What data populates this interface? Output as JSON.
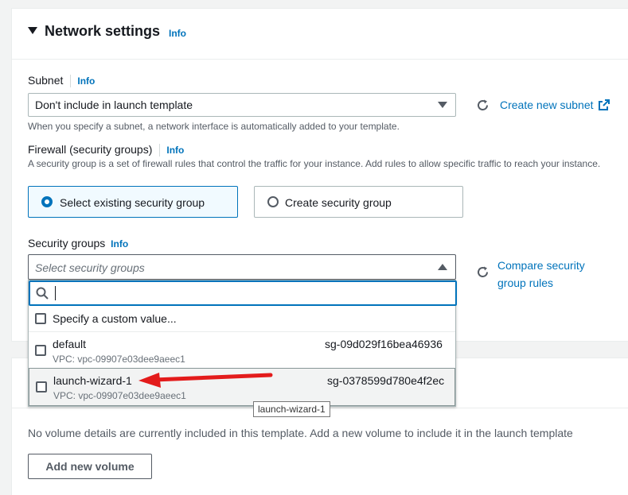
{
  "network": {
    "title": "Network settings",
    "info": "Info",
    "subnet": {
      "label": "Subnet",
      "info": "Info",
      "value": "Don't include in launch template",
      "hint": "When you specify a subnet, a network interface is automatically added to your template.",
      "create_link": "Create new subnet"
    },
    "firewall": {
      "label": "Firewall (security groups)",
      "info": "Info",
      "desc": "A security group is a set of firewall rules that control the traffic for your instance. Add rules to allow specific traffic to reach your instance.",
      "option_existing": "Select existing security group",
      "option_create": "Create security group",
      "selected": "existing"
    },
    "security_groups": {
      "label": "Security groups",
      "info": "Info",
      "placeholder": "Select security groups",
      "compare_link_line1": "Compare security",
      "compare_link_line2": "group rules",
      "search_value": "",
      "custom_option": "Specify a custom value...",
      "options": [
        {
          "name": "default",
          "vpc": "VPC: vpc-09907e03dee9aeec1",
          "id": "sg-09d029f16bea46936"
        },
        {
          "name": "launch-wizard-1",
          "vpc": "VPC: vpc-09907e03dee9aeec1",
          "id": "sg-0378599d780e4f2ec"
        }
      ],
      "tooltip": "launch-wizard-1"
    }
  },
  "storage": {
    "empty_text": "No volume details are currently included in this template. Add a new volume to include it in the launch template",
    "add_button": "Add new volume"
  },
  "colors": {
    "link": "#0073bb",
    "arrow": "#e31b1b",
    "selected_tile_bg": "#f1faff"
  }
}
